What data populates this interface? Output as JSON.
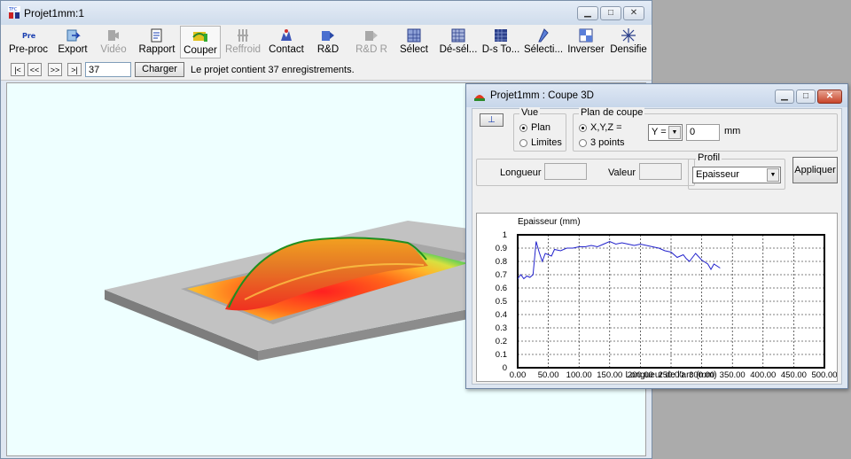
{
  "main": {
    "title": "Projet1mm:1",
    "icon": "tfc-app-icon",
    "window_buttons": [
      "minimize-icon",
      "maximize-icon",
      "close-icon"
    ]
  },
  "toolbar": {
    "items": [
      {
        "label": "Pre-proc",
        "icon": "preproc-icon",
        "enabled": true,
        "active": false
      },
      {
        "label": "Export",
        "icon": "export-icon",
        "enabled": true,
        "active": false
      },
      {
        "label": "Vidéo",
        "icon": "video-icon",
        "enabled": false,
        "active": false
      },
      {
        "label": "Rapport",
        "icon": "report-icon",
        "enabled": true,
        "active": false
      },
      {
        "label": "Couper",
        "icon": "cut-icon",
        "enabled": true,
        "active": true
      },
      {
        "label": "Reffroid",
        "icon": "cooling-icon",
        "enabled": false,
        "active": false
      },
      {
        "label": "Contact",
        "icon": "contact-icon",
        "enabled": true,
        "active": false
      },
      {
        "label": "R&D",
        "icon": "rd-icon",
        "enabled": true,
        "active": false
      },
      {
        "label": "R&D R",
        "icon": "rd-r-icon",
        "enabled": false,
        "active": false
      },
      {
        "label": "Sélect",
        "icon": "select-icon",
        "enabled": true,
        "active": false
      },
      {
        "label": "Dé-sél...",
        "icon": "deselect-icon",
        "enabled": true,
        "active": false
      },
      {
        "label": "D-s To...",
        "icon": "deselect-all-icon",
        "enabled": true,
        "active": false
      },
      {
        "label": "Sélecti...",
        "icon": "selection-tool-icon",
        "enabled": true,
        "active": false
      },
      {
        "label": "Inverser",
        "icon": "invert-icon",
        "enabled": true,
        "active": false
      },
      {
        "label": "Densifie",
        "icon": "densify-icon",
        "enabled": true,
        "active": false
      }
    ]
  },
  "nav": {
    "buttons": [
      "|<",
      "<<",
      ">>",
      ">|"
    ],
    "record_value": "37",
    "load_label": "Charger",
    "status": "Le projet contient 37 enregistrements."
  },
  "dialog": {
    "title": "Projet1mm : Coupe 3D",
    "icon": "3d-cut-icon",
    "window_buttons": [
      "minimize-icon",
      "maximize-icon",
      "close-icon"
    ],
    "pin_icon": "pin-icon",
    "vue": {
      "label": "Vue",
      "options": [
        "Plan",
        "Limites"
      ],
      "selected": "Plan"
    },
    "plan": {
      "label": "Plan de coupe",
      "options": [
        "X,Y,Z =",
        "3 points"
      ],
      "selected": "X,Y,Z =",
      "axis": "Y =",
      "value": "0",
      "unit": "mm"
    },
    "longueur_label": "Longueur",
    "longueur_value": "",
    "valeur_label": "Valeur",
    "valeur_value": "",
    "profil": {
      "label": "Profil",
      "value": "Epaisseur"
    },
    "apply_label": "Appliquer"
  },
  "chart_data": {
    "type": "line",
    "title": "Epaisseur (mm)",
    "xlabel": "Longueur de l'arc (mm)",
    "ylabel": "",
    "xlim": [
      0,
      500
    ],
    "ylim": [
      0,
      1
    ],
    "xticks": [
      "0.00",
      "50.00",
      "100.00",
      "150.00",
      "200.00",
      "250.00",
      "300.00",
      "350.00",
      "400.00",
      "450.00",
      "500.00"
    ],
    "yticks": [
      "0",
      "0.1",
      "0.2",
      "0.3",
      "0.4",
      "0.5",
      "0.6",
      "0.7",
      "0.8",
      "0.9",
      "1"
    ],
    "grid": true,
    "series": [
      {
        "color": "#2222cc",
        "x": [
          0,
          5,
          10,
          15,
          20,
          25,
          30,
          35,
          40,
          45,
          50,
          55,
          60,
          70,
          80,
          90,
          100,
          110,
          120,
          130,
          140,
          150,
          160,
          170,
          180,
          190,
          200,
          210,
          220,
          230,
          240,
          250,
          260,
          270,
          275,
          280,
          285,
          290,
          300,
          310,
          315,
          320,
          330
        ],
        "y": [
          0.67,
          0.7,
          0.67,
          0.69,
          0.68,
          0.7,
          0.95,
          0.87,
          0.8,
          0.86,
          0.85,
          0.84,
          0.89,
          0.88,
          0.9,
          0.9,
          0.91,
          0.91,
          0.92,
          0.91,
          0.93,
          0.95,
          0.93,
          0.94,
          0.93,
          0.92,
          0.93,
          0.92,
          0.91,
          0.9,
          0.88,
          0.87,
          0.83,
          0.85,
          0.82,
          0.8,
          0.83,
          0.86,
          0.81,
          0.78,
          0.74,
          0.78,
          0.75
        ]
      }
    ]
  }
}
